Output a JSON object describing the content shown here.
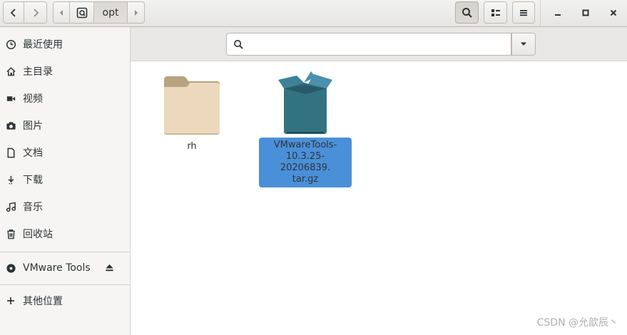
{
  "header": {
    "path_label": "opt",
    "icons": [
      "chevron-left-icon",
      "chevron-right-icon",
      "arrow-left-small-icon",
      "root-drive-icon",
      "arrow-right-small-icon",
      "search-icon",
      "view-toggle-icon",
      "hamburger-menu-icon",
      "minimize-icon",
      "maximize-icon",
      "close-icon"
    ]
  },
  "sidebar": {
    "items": [
      {
        "label": "最近使用",
        "icon": "clock-icon"
      },
      {
        "label": "主目录",
        "icon": "home-icon"
      },
      {
        "label": "视频",
        "icon": "video-icon"
      },
      {
        "label": "图片",
        "icon": "camera-icon"
      },
      {
        "label": "文档",
        "icon": "document-icon"
      },
      {
        "label": "下载",
        "icon": "download-icon"
      },
      {
        "label": "音乐",
        "icon": "music-icon"
      },
      {
        "label": "回收站",
        "icon": "trash-icon"
      }
    ],
    "device": {
      "label": "VMware Tools",
      "icon": "disc-icon",
      "action_icon": "eject-icon"
    },
    "other": {
      "label": "其他位置",
      "icon": "plus-icon"
    }
  },
  "search": {
    "placeholder": ""
  },
  "files": [
    {
      "name": "rh",
      "type": "folder",
      "selected": false
    },
    {
      "name": "VMwareTools-10.3.25-20206839.tar.gz",
      "line1": "VMwareTools-",
      "line2": "10.3.25-20206839.",
      "line3": "tar.gz",
      "type": "archive",
      "selected": true
    }
  ],
  "watermark": "CSDN @允歆辰丶"
}
